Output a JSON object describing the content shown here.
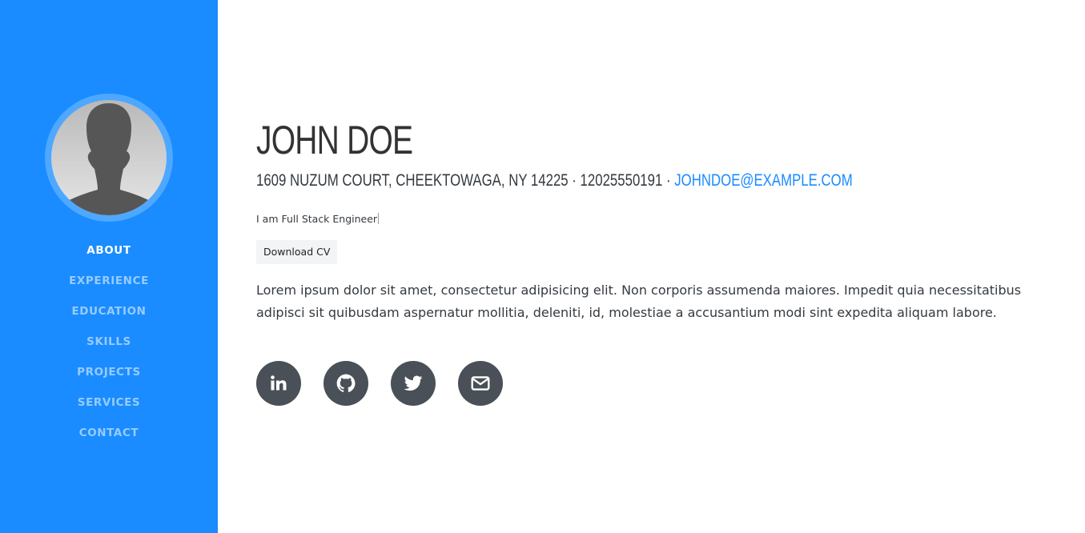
{
  "sidebar": {
    "background": "#1a8cff",
    "nav": [
      {
        "label": "ABOUT",
        "active": true
      },
      {
        "label": "EXPERIENCE"
      },
      {
        "label": "EDUCATION"
      },
      {
        "label": "SKILLS"
      },
      {
        "label": "PROJECTS"
      },
      {
        "label": "SERVICES"
      },
      {
        "label": "CONTACT"
      }
    ]
  },
  "profile": {
    "name": "JOHN DOE",
    "address": "1609 NUZUM COURT, CHEEKTOWAGA, NY 14225 · 12025550191 · ",
    "email": "JOHNDOE@EXAMPLE.COM",
    "tagline": "I am Full Stack Engineer",
    "cv_button": "Download CV",
    "bio": "Lorem ipsum dolor sit amet, consectetur adipisicing elit. Non corporis assumenda maiores. Impedit quia necessitatibus adipisci sit quibusdam aspernatur mollitia, deleniti, id, molestiae a accusantium modi sint expedita aliquam labore."
  },
  "social_icons": [
    "linkedin-icon",
    "github-icon",
    "twitter-icon",
    "envelope-icon"
  ],
  "colors": {
    "accent": "#1a8cff",
    "social_bg": "#495057",
    "text": "#343a40"
  }
}
